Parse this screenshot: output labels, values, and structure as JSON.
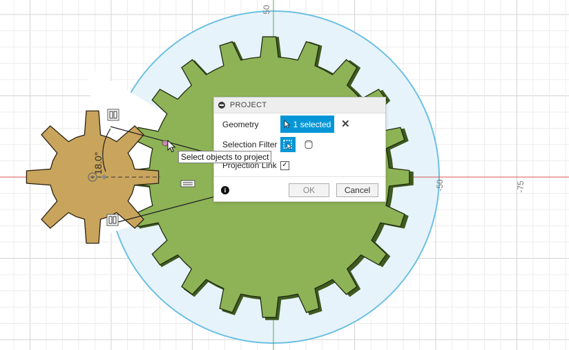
{
  "viewport": {
    "axis_labels": {
      "top_50": "50",
      "right_50": "-50",
      "right_75": "-75"
    },
    "dimension_angle": "18.0°"
  },
  "dialog": {
    "title": "PROJECT",
    "geometry_label": "Geometry",
    "geometry_value": "1 selected",
    "selection_filter_label": "Selection Filter",
    "projection_link_label": "Projection Link",
    "projection_link_checked": true,
    "ok_label": "OK",
    "cancel_label": "Cancel"
  },
  "tooltip": {
    "text": "Select objects to project"
  },
  "colors": {
    "large_gear": "#8db356",
    "small_gear": "#c9a45c",
    "sketch_circle": "#6cc0e3",
    "accent": "#0696d7"
  }
}
